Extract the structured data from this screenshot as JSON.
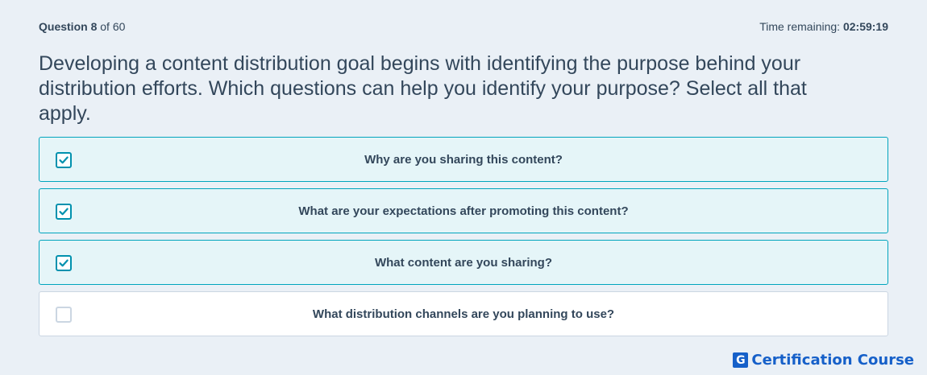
{
  "header": {
    "question_label": "Question",
    "question_number": "8",
    "question_of": "of 60",
    "time_label": "Time remaining:",
    "time_value": "02:59:19"
  },
  "question": {
    "text": "Developing a content distribution goal begins with identifying the purpose behind your distribution efforts. Which questions can help you identify your purpose? Select all that apply."
  },
  "options": [
    {
      "label": "Why are you sharing this content?",
      "checked": true
    },
    {
      "label": "What are your expectations after promoting this content?",
      "checked": true
    },
    {
      "label": "What content are you sharing?",
      "checked": true
    },
    {
      "label": "What distribution channels are you planning to use?",
      "checked": false
    }
  ],
  "brand": {
    "icon_letter": "G",
    "text": "Certification Course",
    "color": "#1660c9"
  },
  "colors": {
    "background": "#eaf0f6",
    "text": "#33475b",
    "accent": "#00a4bd",
    "selected_bg": "#e5f5f8"
  }
}
